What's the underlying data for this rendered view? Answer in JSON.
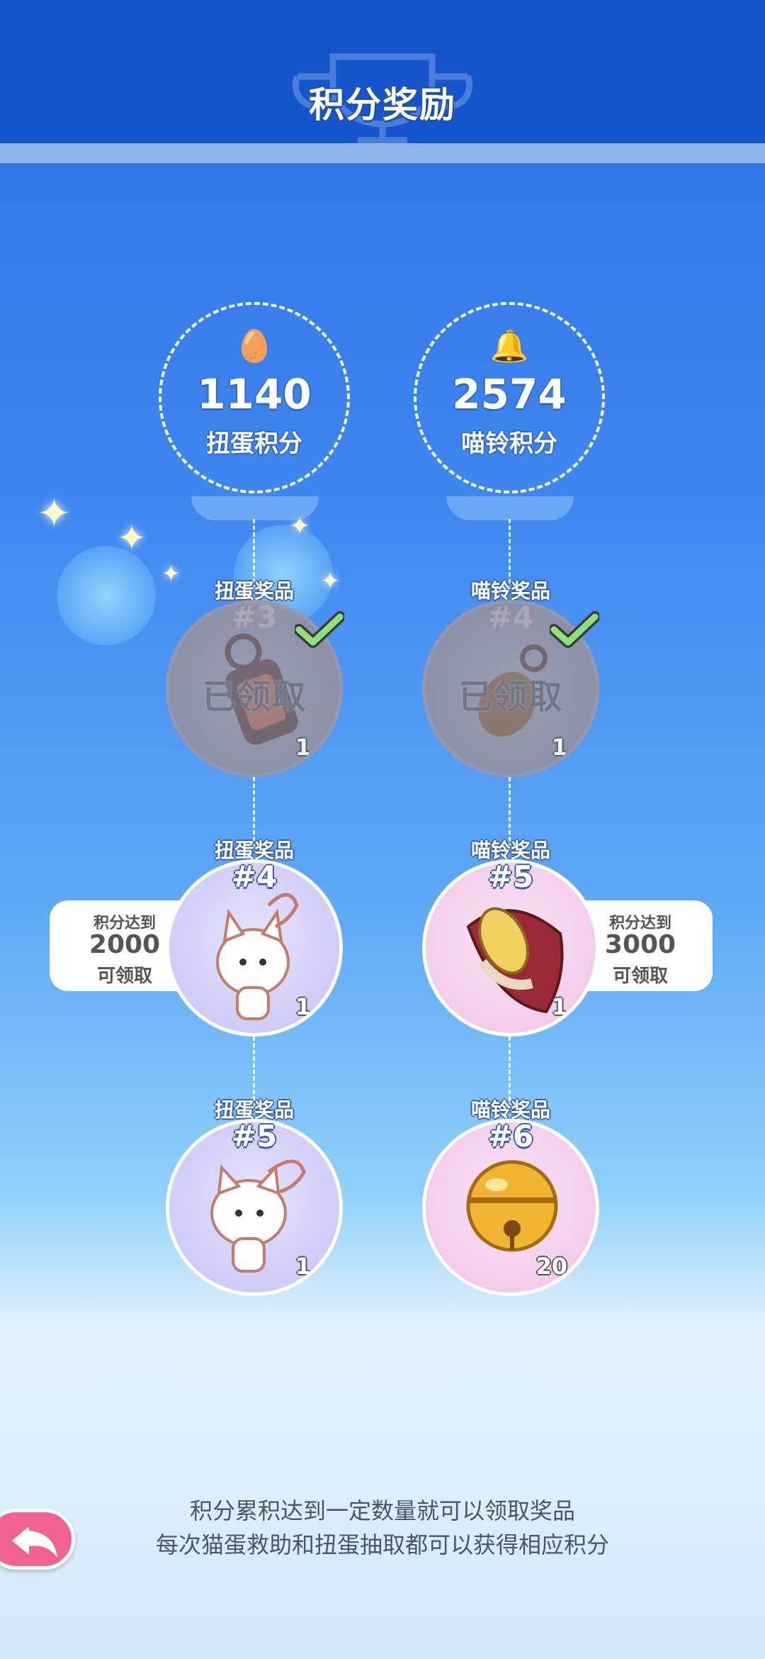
{
  "header": {
    "title": "积分奖励"
  },
  "scores": [
    {
      "icon": "egg-icon",
      "value": "1140",
      "label": "扭蛋积分"
    },
    {
      "icon": "bell-icon",
      "value": "2574",
      "label": "喵铃积分"
    }
  ],
  "prizes": {
    "left": [
      {
        "label": "扭蛋奖品",
        "num": "#3",
        "qty": "1",
        "status": "已领取",
        "claimed": true,
        "item": "lantern-icon"
      },
      {
        "label": "扭蛋奖品",
        "num": "#4",
        "qty": "1",
        "item": "cat-plush-icon"
      },
      {
        "label": "扭蛋奖品",
        "num": "#5",
        "qty": "1",
        "item": "bunny-cat-plush-icon"
      }
    ],
    "right": [
      {
        "label": "喵铃奖品",
        "num": "#4",
        "qty": "1",
        "status": "已领取",
        "claimed": true,
        "item": "bell-lantern-icon"
      },
      {
        "label": "喵铃奖品",
        "num": "#5",
        "qty": "1",
        "item": "corn-scarf-icon"
      },
      {
        "label": "喵铃奖品",
        "num": "#6",
        "qty": "20",
        "item": "golden-bell-icon"
      }
    ]
  },
  "requirements": [
    {
      "line1": "积分达到",
      "value": "2000",
      "line3": "可领取"
    },
    {
      "line1": "积分达到",
      "value": "3000",
      "line3": "可领取"
    }
  ],
  "footer": {
    "line1": "积分累积达到一定数量就可以领取奖品",
    "line2": "每次猫蛋救助和扭蛋抽取都可以获得相应积分"
  },
  "colors": {
    "header": "#1556cc",
    "accent_pink": "#f06292",
    "check_green": "#8ee07a"
  }
}
